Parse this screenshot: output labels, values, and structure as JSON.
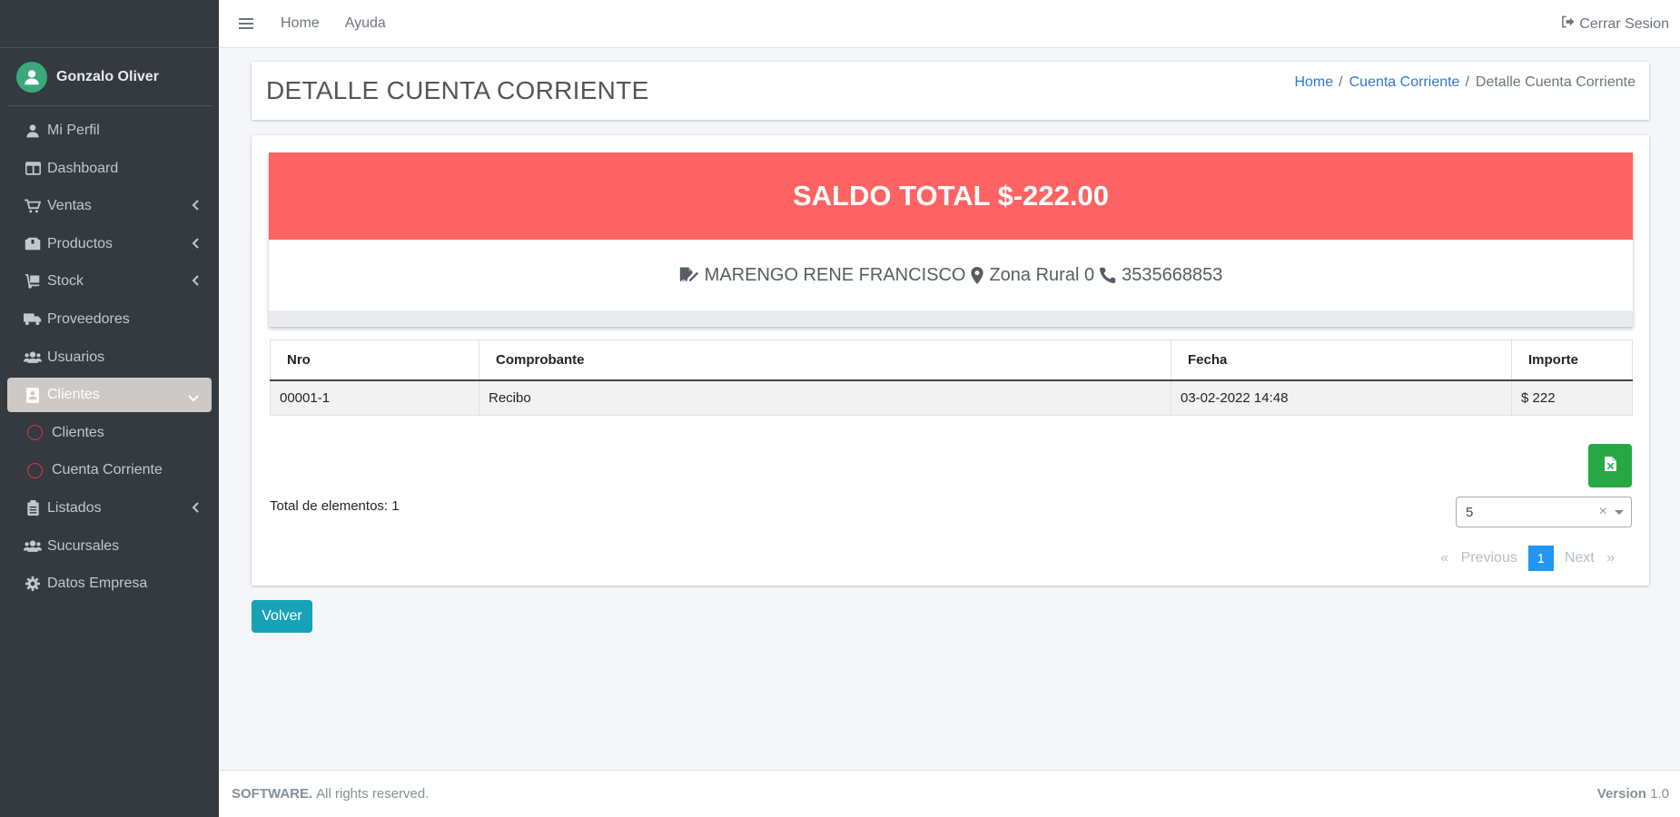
{
  "user": {
    "name": "Gonzalo Oliver",
    "avatar_icon": "user-icon"
  },
  "sidebar": {
    "items": [
      {
        "label": "Mi Perfil",
        "icon": "user-icon"
      },
      {
        "label": "Dashboard",
        "icon": "columns-icon"
      },
      {
        "label": "Ventas",
        "icon": "cart-icon",
        "chevron": "left"
      },
      {
        "label": "Productos",
        "icon": "boxes-icon",
        "chevron": "left"
      },
      {
        "label": "Stock",
        "icon": "dolly-icon",
        "chevron": "left"
      },
      {
        "label": "Proveedores",
        "icon": "truck-icon"
      },
      {
        "label": "Usuarios",
        "icon": "users-icon"
      },
      {
        "label": "Clientes",
        "icon": "contact-icon",
        "chevron": "down",
        "active": true
      },
      {
        "label": "Clientes",
        "icon": "circle-icon",
        "sub": true
      },
      {
        "label": "Cuenta Corriente",
        "icon": "circle-icon",
        "sub": true
      },
      {
        "label": "Listados",
        "icon": "clipboard-icon",
        "chevron": "left"
      },
      {
        "label": "Sucursales",
        "icon": "users-icon"
      },
      {
        "label": "Datos Empresa",
        "icon": "gear-icon"
      }
    ]
  },
  "topbar": {
    "links": [
      "Home",
      "Ayuda"
    ],
    "logout_label": "Cerrar Sesion"
  },
  "header": {
    "title": "DETALLE CUENTA CORRIENTE",
    "breadcrumb": [
      "Home",
      "Cuenta Corriente",
      "Detalle Cuenta Corriente"
    ]
  },
  "saldo": {
    "label": "SALDO TOTAL $-222.00",
    "cliente": "MARENGO RENE FRANCISCO",
    "direccion": "Zona Rural 0",
    "telefono": "3535668853"
  },
  "table": {
    "headers": [
      "Nro",
      "Comprobante",
      "Fecha",
      "Importe"
    ],
    "rows": [
      [
        "00001-1",
        "Recibo",
        "03-02-2022 14:48",
        "$ 222"
      ]
    ]
  },
  "total_elementos": "Total de elementos: 1",
  "page_size": "5",
  "pager": {
    "prev": "Previous",
    "next": "Next",
    "current": "1",
    "prev_glyph": "«",
    "next_glyph": "»"
  },
  "volver_label": "Volver",
  "footer": {
    "brand": "SOFTWARE.",
    "rights": "All rights reserved.",
    "version_label": "Version",
    "version": "1.0"
  },
  "colors": {
    "saldo_banner": "#fd6363",
    "excel": "#28a745",
    "volver": "#17a2b8",
    "active_nav": "#cdc9c6",
    "sidebar": "#343a40"
  }
}
